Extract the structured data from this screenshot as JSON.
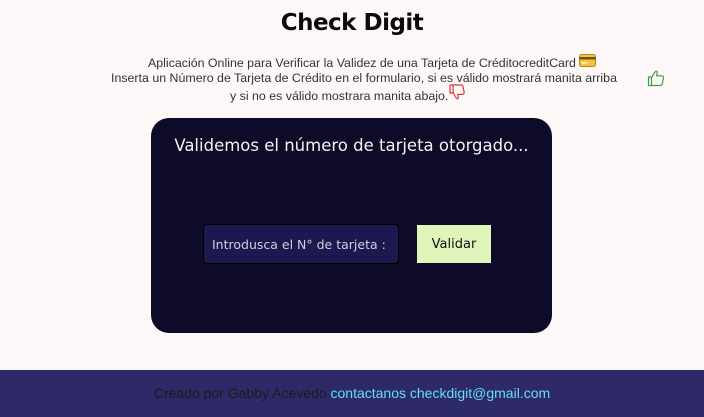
{
  "header": {
    "title": "Check Digit"
  },
  "description": {
    "line1": "Aplicación Online para Verificar la Validez de una Tarjeta de CréditocreditCard",
    "line2": "Inserta un Número de Tarjeta de Crédito en el formulario, si es válido mostrará manita arriba",
    "line3": "y si no es válido mostrara manita abajo.",
    "icons": [
      "credit-card-icon",
      "thumbs-up-icon",
      "thumbs-down-icon"
    ]
  },
  "validator": {
    "heading": "Validemos el número de tarjeta otorgado...",
    "input_placeholder": "Introdusca el N° de tarjeta :",
    "input_value": "",
    "button_label": "Validar"
  },
  "footer": {
    "credit": "Creado por Gabby Acevedo",
    "contact": "contactanos checkdigit@gmail.com"
  },
  "colors": {
    "page_background": "#fdf8f7",
    "panel_background": "#0d0b27",
    "input_background": "#1c1850",
    "button_background": "#dff5b9",
    "footer_background": "#2e2a68",
    "link": "#66dcf5",
    "thumbs_up": "#3aa34a",
    "thumbs_down": "#d9363e"
  }
}
